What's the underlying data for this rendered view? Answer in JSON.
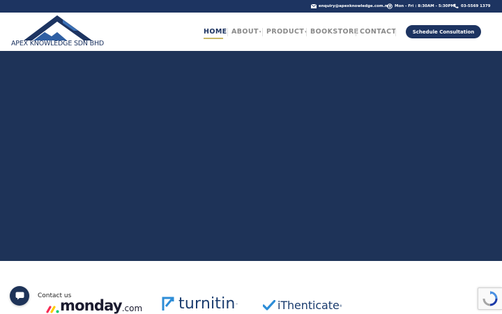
{
  "topbar": {
    "email": "enquiry@apexknowledge.com.my",
    "hours": "Mon - Fri : 8:30AM - 5:30PM",
    "phone": "03-5569 1379"
  },
  "brand": {
    "name": "APEX KNOWLEDGE SDN BHD"
  },
  "nav": {
    "items": [
      {
        "label": "HOME",
        "active": true,
        "has_dropdown": false
      },
      {
        "label": "ABOUT",
        "active": false,
        "has_dropdown": true
      },
      {
        "label": "PRODUCT",
        "active": false,
        "has_dropdown": true
      },
      {
        "label": "BOOKSTORE",
        "active": false,
        "has_dropdown": false
      },
      {
        "label": "CONTACT",
        "active": false,
        "has_dropdown": false
      }
    ],
    "cta_label": "Schedule Consultation"
  },
  "partners": {
    "monday": {
      "word": "monday",
      "suffix": ".com"
    },
    "turnitin": {
      "word": "turnitin"
    },
    "ithenticate": {
      "word": "iThenticate"
    }
  },
  "floating": {
    "contact_label": "Contact us"
  },
  "icons": {
    "email": "envelope-icon",
    "hours": "clock-icon",
    "phone": "phone-icon",
    "contact": "chat-bubble-icon",
    "recaptcha": "recaptcha-icon",
    "caret": "chevron-down-icon"
  },
  "colors": {
    "brand_navy": "#1d3461",
    "hero_bg": "#1e3358",
    "nav_inactive": "#8a8a8a",
    "nav_underline": "#c9b866"
  }
}
